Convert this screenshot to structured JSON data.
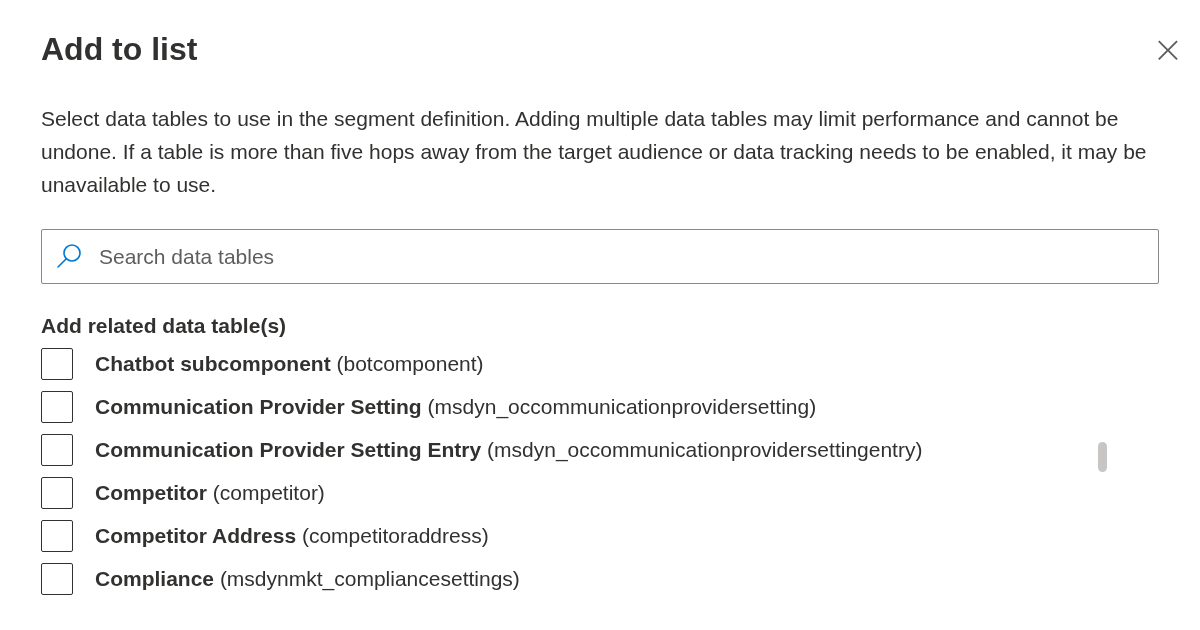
{
  "dialog": {
    "title": "Add to list",
    "close": "×",
    "description": "Select data tables to use in the segment definition. Adding multiple data tables may limit performance and cannot be undone. If a table is more than five hops away from the target audience or data tracking needs to be enabled, it may be unavailable to use."
  },
  "search": {
    "placeholder": "Search data tables"
  },
  "section_label": "Add related data table(s)",
  "tables": [
    {
      "name": "Chatbot subcomponent",
      "logical_name": "(botcomponent)",
      "checked": false
    },
    {
      "name": "Communication Provider Setting",
      "logical_name": "(msdyn_occommunicationprovidersetting)",
      "checked": false
    },
    {
      "name": "Communication Provider Setting Entry",
      "logical_name": "(msdyn_occommunicationprovidersettingentry)",
      "checked": false
    },
    {
      "name": "Competitor",
      "logical_name": "(competitor)",
      "checked": false
    },
    {
      "name": "Competitor Address",
      "logical_name": "(competitoraddress)",
      "checked": false
    },
    {
      "name": "Compliance",
      "logical_name": "(msdynmkt_compliancesettings)",
      "checked": false
    }
  ]
}
